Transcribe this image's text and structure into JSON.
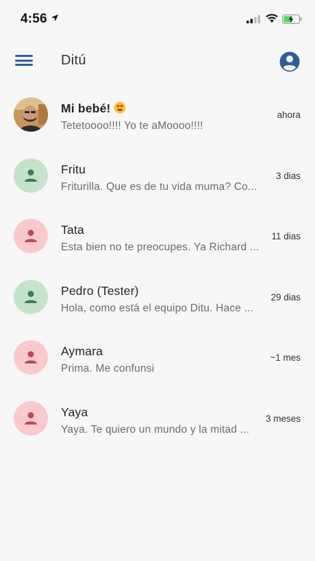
{
  "status": {
    "time": "4:56"
  },
  "app": {
    "title": "Ditú"
  },
  "icons": {
    "menu": "hamburger-menu-icon",
    "account": "account-circle-icon",
    "person": "person-icon"
  },
  "colors": {
    "primary": "#2d5d9c",
    "avatar_green_bg": "#c5e3cb",
    "avatar_green_fg": "#3a7d55",
    "avatar_pink_bg": "#f9c9cd",
    "avatar_pink_fg": "#b94a5a"
  },
  "chats": [
    {
      "name": "Mi bebé!",
      "emoji": "heart-eyes-emoji",
      "message": "Tetetoooo!!!! Yo te aMoooo!!!!",
      "time": "ahora",
      "avatar": "photo",
      "bold": true
    },
    {
      "name": "Fritu",
      "message": "Friturilla. Que es de tu vida muma? Co...",
      "time": "3 dias",
      "avatar": "green"
    },
    {
      "name": "Tata",
      "message": "Esta bien no te preocupes. Ya Richard ...",
      "time": "11 dias",
      "avatar": "pink"
    },
    {
      "name": "Pedro (Tester)",
      "message": "Hola, como está el equipo Ditu. Hace ...",
      "time": "29 dias",
      "avatar": "green"
    },
    {
      "name": "Aymara",
      "message": "Prima. Me confunsi",
      "time": "~1 mes",
      "avatar": "pink"
    },
    {
      "name": "Yaya",
      "message": "Yaya. Te quiero un mundo y la mitad ...",
      "time": "3 meses",
      "avatar": "pink"
    }
  ]
}
